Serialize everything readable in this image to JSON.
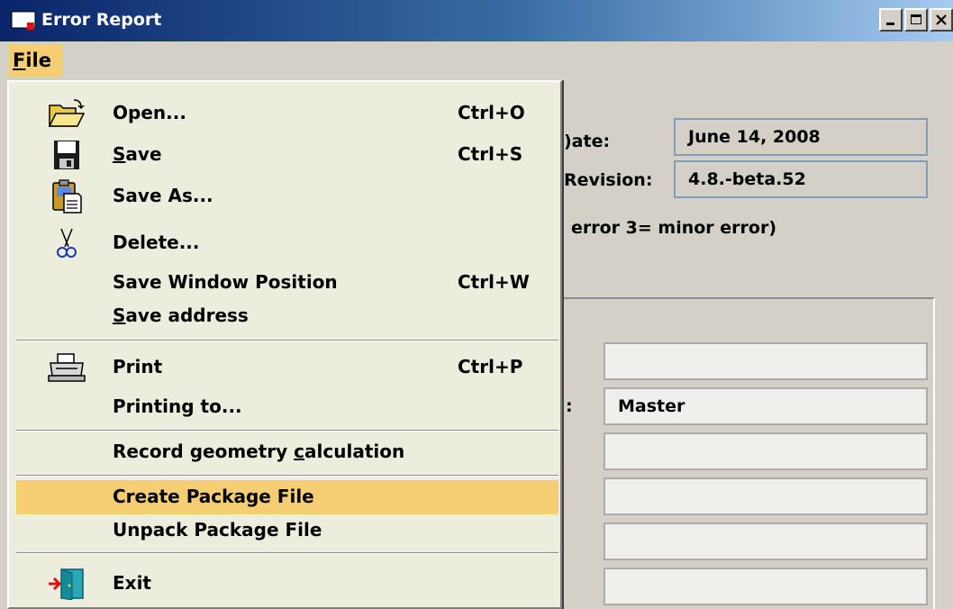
{
  "window": {
    "title": "Error Report",
    "controls": {
      "minimize": "_",
      "maximize": "□",
      "close": "×"
    }
  },
  "menubar": {
    "file": "File",
    "file_mnemonic": "F",
    "file_rest": "ile"
  },
  "background": {
    "date_label": ")ate:",
    "date_value": "June 14, 2008",
    "revision_label": "Revision:",
    "revision_value": "4.8.-beta.52",
    "legend_text": "error 3= minor error)",
    "colon": ":",
    "fields": [
      "",
      "Master",
      "",
      "",
      "",
      ""
    ]
  },
  "file_menu": {
    "items": [
      {
        "label": "Open...",
        "shortcut": "Ctrl+O",
        "icon": "open-folder-icon"
      },
      {
        "label_pre": "",
        "label_u": "S",
        "label_post": "ave",
        "shortcut": "Ctrl+S",
        "icon": "floppy-disk-icon"
      },
      {
        "label": "Save As...",
        "shortcut": "",
        "icon": "clipboard-document-icon"
      },
      {
        "label": "Delete...",
        "shortcut": "",
        "icon": "scissors-icon"
      },
      {
        "label": "Save Window Position",
        "shortcut": "Ctrl+W",
        "icon": ""
      },
      {
        "label_pre": "",
        "label_u": "S",
        "label_post": "ave address",
        "shortcut": "",
        "icon": ""
      },
      {
        "label": "Print",
        "shortcut": "Ctrl+P",
        "icon": "printer-icon"
      },
      {
        "label": "Printing to...",
        "shortcut": "",
        "icon": ""
      },
      {
        "label_pre": "Record geometry ",
        "label_u": "c",
        "label_post": "alculation",
        "shortcut": "",
        "icon": ""
      },
      {
        "label": "Create Package File",
        "shortcut": "",
        "icon": ""
      },
      {
        "label": "Unpack Package File",
        "shortcut": "",
        "icon": ""
      },
      {
        "label": "Exit",
        "shortcut": "",
        "icon": "exit-door-icon"
      }
    ],
    "highlighted": "Create Package File"
  },
  "colors": {
    "highlight": "#f5cd72",
    "menu_bg": "#ededde",
    "window_bg": "#d4d0c8",
    "titlebar": "#0a246a"
  }
}
